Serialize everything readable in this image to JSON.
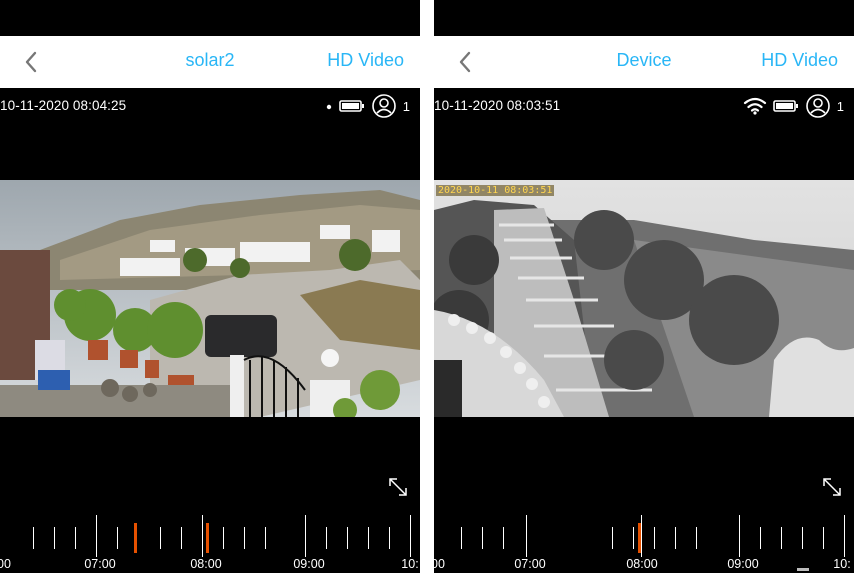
{
  "left": {
    "title": "solar2",
    "hd_label": "HD Video",
    "timestamp": "10-11-2020 08:04:25",
    "viewer_count": "1",
    "timeline_labels": [
      "00",
      "07:00",
      "08:00",
      "09:00",
      "10:"
    ]
  },
  "right": {
    "title": "Device",
    "hd_label": "HD Video",
    "timestamp": "10-11-2020 08:03:51",
    "viewer_count": "1",
    "camera_overlay": "2020-10-11  08:03:51",
    "timeline_labels": [
      "00",
      "07:00",
      "08:00",
      "09:00",
      "10:"
    ]
  },
  "colors": {
    "accent": "#29b6f6",
    "event": "#e65100"
  }
}
